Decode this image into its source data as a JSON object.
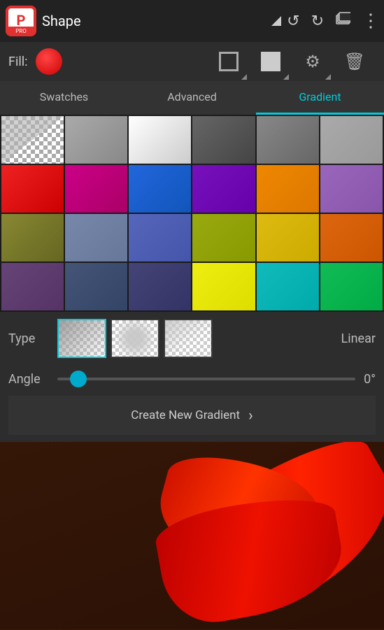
{
  "toolbar": {
    "title": "Shape",
    "logo_text": "P",
    "logo_sub": "PRO",
    "undo_label": "↺",
    "redo_label": "↻",
    "layers_label": "⧉",
    "more_label": "⋮"
  },
  "fill_bar": {
    "label": "Fill:",
    "buttons": [
      {
        "name": "outline-square",
        "type": "outline"
      },
      {
        "name": "filled-square",
        "type": "filled"
      },
      {
        "name": "gear",
        "type": "gear"
      },
      {
        "name": "trash",
        "type": "trash"
      }
    ]
  },
  "tabs": [
    {
      "label": "Swatches",
      "id": "swatches",
      "active": false
    },
    {
      "label": "Advanced",
      "id": "advanced",
      "active": false
    },
    {
      "label": "Gradient",
      "id": "gradient",
      "active": true
    }
  ],
  "swatches": [
    {
      "color": "checkered",
      "row": 0,
      "col": 0
    },
    {
      "color": "#888888",
      "row": 0,
      "col": 1
    },
    {
      "color": "#cccccc",
      "row": 0,
      "col": 2
    },
    {
      "color": "#444444",
      "row": 0,
      "col": 3
    },
    {
      "color": "#666666",
      "row": 0,
      "col": 4
    },
    {
      "color": "#999999",
      "row": 0,
      "col": 5
    },
    {
      "color": "#cc0000",
      "row": 1,
      "col": 0
    },
    {
      "color": "#aa0077",
      "row": 1,
      "col": 1
    },
    {
      "color": "#1155cc",
      "row": 1,
      "col": 2
    },
    {
      "color": "#6600aa",
      "row": 1,
      "col": 3
    },
    {
      "color": "#dd7700",
      "row": 1,
      "col": 4
    },
    {
      "color": "#8855aa",
      "row": 1,
      "col": 5
    },
    {
      "color": "#666622",
      "row": 2,
      "col": 0
    },
    {
      "color": "#667799",
      "row": 2,
      "col": 1
    },
    {
      "color": "#4455aa",
      "row": 2,
      "col": 2
    },
    {
      "color": "#889900",
      "row": 2,
      "col": 3
    },
    {
      "color": "#ccaa00",
      "row": 2,
      "col": 4
    },
    {
      "color": "#cc5500",
      "row": 2,
      "col": 5
    },
    {
      "color": "#553366",
      "row": 3,
      "col": 0
    },
    {
      "color": "#334466",
      "row": 3,
      "col": 1
    },
    {
      "color": "#333366",
      "row": 3,
      "col": 2
    },
    {
      "color": "#dddd00",
      "row": 3,
      "col": 3
    },
    {
      "color": "#00aaaa",
      "row": 3,
      "col": 4
    },
    {
      "color": "#00aa44",
      "row": 3,
      "col": 5
    }
  ],
  "gradient": {
    "type_label": "Type",
    "type_value": "Linear",
    "angle_label": "Angle",
    "angle_value": "0°",
    "create_btn_label": "Create New Gradient",
    "create_btn_arrow": "›",
    "types": [
      {
        "name": "linear",
        "selected": true
      },
      {
        "name": "radial",
        "selected": false
      },
      {
        "name": "sweep",
        "selected": false
      }
    ]
  }
}
